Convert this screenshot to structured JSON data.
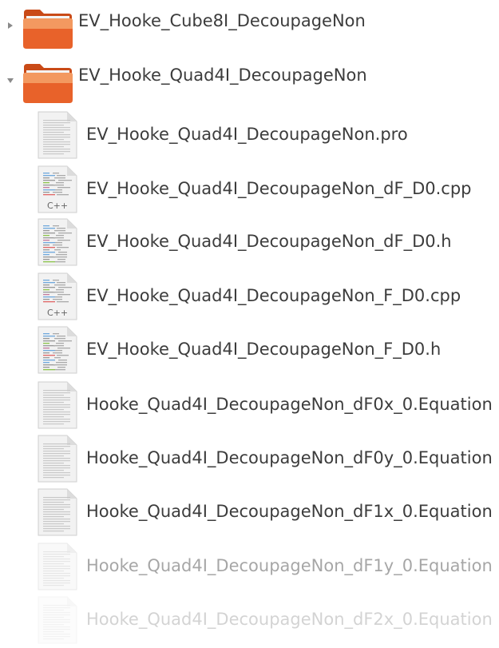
{
  "colors": {
    "folder_top": "#f5a36a",
    "folder_body": "#e8622a",
    "folder_dark": "#c94a17",
    "text": "#3c3c3c",
    "page_bg": "#f2f2f2",
    "page_lines": "#c8c8c8"
  },
  "tree": {
    "items": [
      {
        "label": "EV_Hooke_Cube8I_DecoupageNon",
        "kind": "folder",
        "expander": "collapsed",
        "icon": "folder-icon"
      },
      {
        "label": "EV_Hooke_Quad4I_DecoupageNon",
        "kind": "folder",
        "expander": "expanded",
        "icon": "folder-icon"
      },
      {
        "label": "EV_Hooke_Quad4I_DecoupageNon.pro",
        "kind": "file",
        "icon": "text-file-icon"
      },
      {
        "label": "EV_Hooke_Quad4I_DecoupageNon_dF_D0.cpp",
        "kind": "file",
        "icon": "cpp-source-icon",
        "badge": "C++"
      },
      {
        "label": "EV_Hooke_Quad4I_DecoupageNon_dF_D0.h",
        "kind": "file",
        "icon": "header-source-icon"
      },
      {
        "label": "EV_Hooke_Quad4I_DecoupageNon_F_D0.cpp",
        "kind": "file",
        "icon": "cpp-source-icon",
        "badge": "C++"
      },
      {
        "label": "EV_Hooke_Quad4I_DecoupageNon_F_D0.h",
        "kind": "file",
        "icon": "header-source-icon"
      },
      {
        "label": "Hooke_Quad4I_DecoupageNon_dF0x_0.Equation",
        "kind": "file",
        "icon": "text-file-icon"
      },
      {
        "label": "Hooke_Quad4I_DecoupageNon_dF0y_0.Equation",
        "kind": "file",
        "icon": "text-file-icon"
      },
      {
        "label": "Hooke_Quad4I_DecoupageNon_dF1x_0.Equation",
        "kind": "file",
        "icon": "text-file-icon"
      },
      {
        "label": "Hooke_Quad4I_DecoupageNon_dF1y_0.Equation",
        "kind": "file",
        "icon": "text-file-icon"
      },
      {
        "label": "Hooke_Quad4I_DecoupageNon_dF2x_0.Equation",
        "kind": "file",
        "icon": "text-file-icon"
      }
    ]
  }
}
